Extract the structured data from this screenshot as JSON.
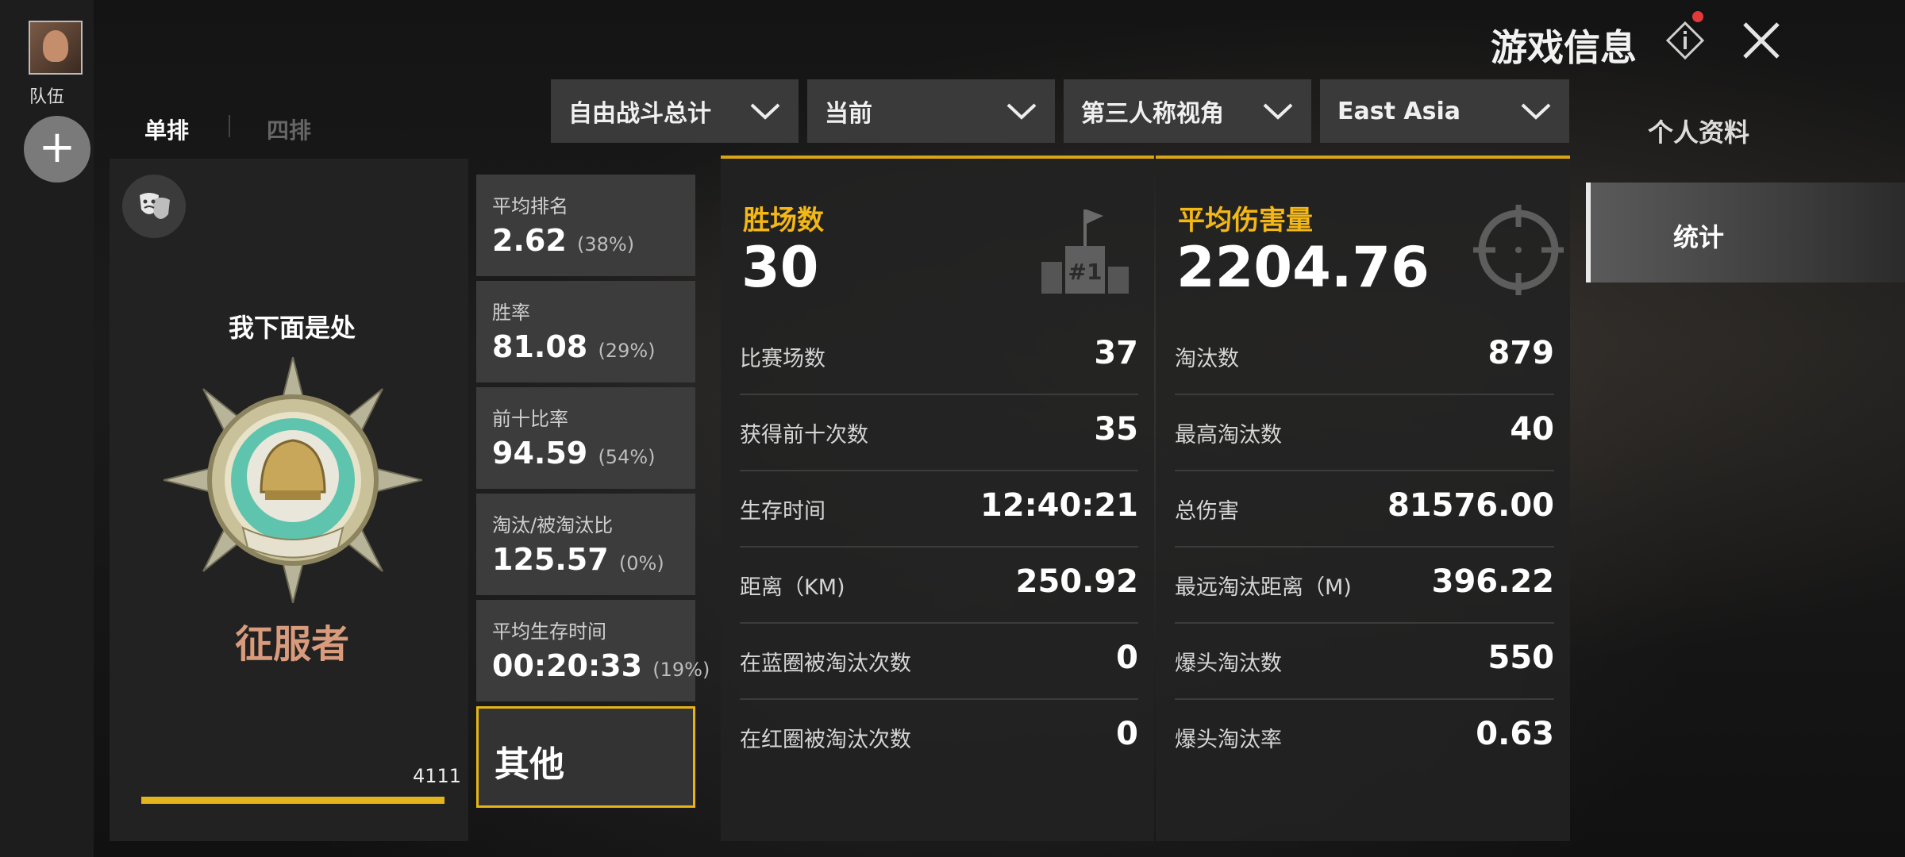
{
  "sidebar": {
    "team_label": "队伍",
    "add_label": "+"
  },
  "header": {
    "title": "游戏信息"
  },
  "modes": {
    "solo": "单排",
    "squad": "四排"
  },
  "filters": [
    {
      "label": "自由战斗总计"
    },
    {
      "label": "当前"
    },
    {
      "label": "第三人称视角"
    },
    {
      "label": "East Asia"
    }
  ],
  "side_nav": {
    "profile": "个人资料",
    "stats": "统计"
  },
  "player": {
    "name": "我下面是处",
    "rank": "征服者",
    "points": "4111",
    "rank_progress": 1.0
  },
  "summary_cards": [
    {
      "label": "平均排名",
      "value": "2.62",
      "pct": "(38%)"
    },
    {
      "label": "胜率",
      "value": "81.08",
      "pct": "(29%)"
    },
    {
      "label": "前十比率",
      "value": "94.59",
      "pct": "(54%)"
    },
    {
      "label": "淘汰/被淘汰比",
      "value": "125.57",
      "pct": "(0%)"
    },
    {
      "label": "平均生存时间",
      "value": "00:20:33",
      "pct": "(19%)"
    }
  ],
  "other_button": "其他",
  "wins_panel": {
    "label": "胜场数",
    "value": "30",
    "icon_text": "#1",
    "rows": [
      {
        "label": "比赛场数",
        "value": "37"
      },
      {
        "label": "获得前十次数",
        "value": "35"
      },
      {
        "label": "生存时间",
        "value": "12:40:21"
      },
      {
        "label": "距离（KM)",
        "value": "250.92"
      },
      {
        "label": "在蓝圈被淘汰次数",
        "value": "0"
      },
      {
        "label": "在红圈被淘汰次数",
        "value": "0"
      }
    ]
  },
  "damage_panel": {
    "label": "平均伤害量",
    "value": "2204.76",
    "rows": [
      {
        "label": "淘汰数",
        "value": "879"
      },
      {
        "label": "最高淘汰数",
        "value": "40"
      },
      {
        "label": "总伤害",
        "value": "81576.00"
      },
      {
        "label": "最远淘汰距离（M)",
        "value": "396.22"
      },
      {
        "label": "爆头淘汰数",
        "value": "550"
      },
      {
        "label": "爆头淘汰率",
        "value": "0.63"
      }
    ]
  },
  "colors": {
    "accent": "#e6b417",
    "rank_name": "#d89b7c",
    "panel": "#222222",
    "card": "#3c3c3c"
  }
}
